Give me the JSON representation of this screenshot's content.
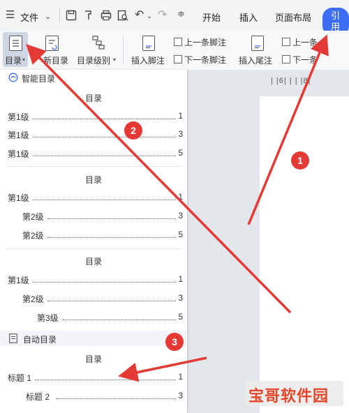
{
  "menubar": {
    "file_label": "文件",
    "tabs": [
      {
        "label": "开始"
      },
      {
        "label": "插入"
      },
      {
        "label": "页面布局"
      },
      {
        "label": "引用"
      }
    ]
  },
  "ribbon": {
    "toc_label": "目录",
    "update_toc_label": "新目录",
    "toc_level_label": "目录级别",
    "insert_footnote_label": "插入脚注",
    "prev_footnote_label": "上一条脚注",
    "next_footnote_label": "下一条脚注",
    "insert_endnote_label": "插入尾注",
    "prev_endnote_label": "上一条",
    "next_endnote_label": "下一条"
  },
  "ruler": {
    "marks": "| |6|  |  |  |8|"
  },
  "panel": {
    "smart_toc_header": "智能目录",
    "auto_toc_header": "自动目录",
    "toc_blocks": [
      {
        "title": "目录",
        "entries": [
          {
            "label": "第1级",
            "page": "1"
          },
          {
            "label": "第1级",
            "page": "3"
          },
          {
            "label": "第1级",
            "page": "5"
          }
        ]
      },
      {
        "title": "目录",
        "entries": [
          {
            "label": "第1级",
            "page": "1"
          },
          {
            "label": "第2级",
            "page": "3"
          },
          {
            "label": "第2级",
            "page": "5"
          }
        ]
      },
      {
        "title": "目录",
        "entries": [
          {
            "label": "第1级",
            "page": "1"
          },
          {
            "label": "第2级",
            "page": "3"
          },
          {
            "label": "第3级",
            "page": "5"
          }
        ]
      }
    ],
    "auto_block": {
      "title": "目录",
      "entries": [
        {
          "label": "标题 1",
          "page": "1"
        },
        {
          "label": "标题 2",
          "page": "3"
        }
      ]
    }
  },
  "badges": [
    "1",
    "2",
    "3"
  ],
  "watermark": "宝哥软件园",
  "colors": {
    "badge": "#e53935",
    "arrow": "#e53935",
    "accent_tab": "#3b6ef5",
    "watermark_text": "#e4472c"
  }
}
